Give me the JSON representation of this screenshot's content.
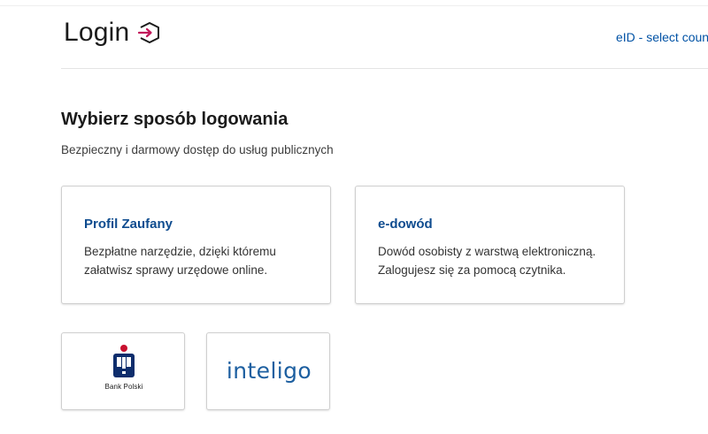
{
  "header": {
    "title": "Login",
    "eid_link": "eID - select country"
  },
  "main": {
    "heading": "Wybierz sposób logowania",
    "subtitle": "Bezpieczny i darmowy dostęp do usług publicznych",
    "methods": [
      {
        "title": "Profil Zaufany",
        "description_line1": "Bezpłatne narzędzie, dzięki któremu",
        "description_line2": "załatwisz sprawy urzędowe online."
      },
      {
        "title": "e-dowód",
        "description_line1": "Dowód osobisty z warstwą elektroniczną.",
        "description_line2": "Zalogujesz się za pomocą czytnika."
      }
    ],
    "banks": [
      {
        "name": "Bank Polski",
        "icon": "pko-bank-polski-logo"
      },
      {
        "name": "inteligo",
        "icon": "inteligo-logo"
      }
    ]
  },
  "colors": {
    "link": "#0052a5",
    "card_title": "#0f4c8f",
    "login_arrow": "#c2185b",
    "pko_navy": "#0d2d6c",
    "inteligo_blue": "#1d5fa0"
  }
}
